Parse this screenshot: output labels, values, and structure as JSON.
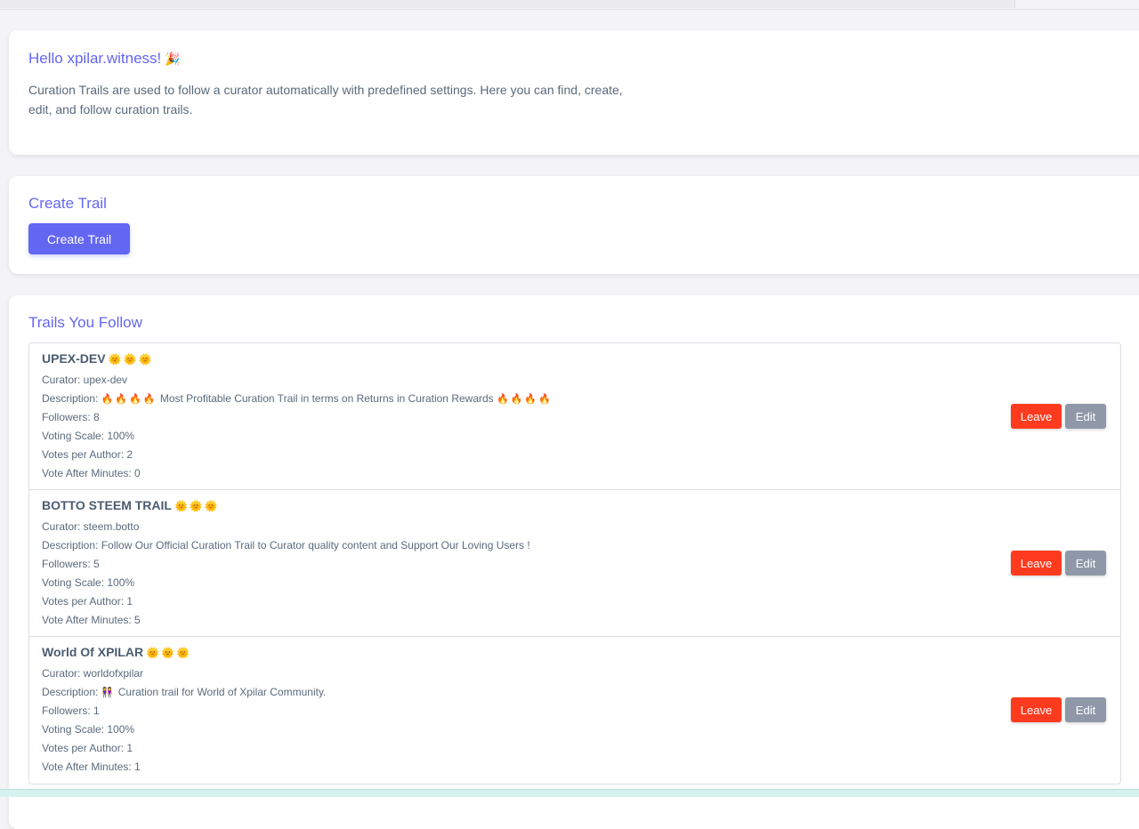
{
  "colors": {
    "accent": "#6366f1",
    "leave": "#ff3b1f",
    "edit": "#8e98a8",
    "text": "#5b6a7c"
  },
  "hello": {
    "title": "Hello xpilar.witness!",
    "title_emoji": "🎉",
    "text": "Curation Trails are used to follow a curator automatically with predefined settings. Here you can find, create, edit, and follow curation trails."
  },
  "create": {
    "title": "Create Trail",
    "button_label": "Create Trail"
  },
  "follow": {
    "title": "Trails You Follow",
    "leave_label": "Leave",
    "edit_label": "Edit",
    "trails": [
      {
        "name": "UPEX-DEV",
        "badges": "🌞🌞🌞",
        "curator": "Curator: upex-dev",
        "description_label": "Description:",
        "description_emoji_pre": "🔥🔥🔥🔥",
        "description": "Most Profitable Curation Trail in terms on Returns in Curation Rewards",
        "description_emoji_post": "🔥🔥🔥🔥",
        "followers": "Followers: 8",
        "voting_scale": "Voting Scale: 100%",
        "votes_per_author": "Votes per Author: 2",
        "vote_after": "Vote After Minutes: 0"
      },
      {
        "name": "BOTTO STEEM TRAIL",
        "badges": "🌞🌞🌞",
        "curator": "Curator: steem.botto",
        "description_label": "Description:",
        "description_emoji_pre": "",
        "description": "Follow Our Official Curation Trail to Curator quality content and Support Our Loving Users !",
        "description_emoji_post": "",
        "followers": "Followers: 5",
        "voting_scale": "Voting Scale: 100%",
        "votes_per_author": "Votes per Author: 1",
        "vote_after": "Vote After Minutes: 5"
      },
      {
        "name": "World Of XPILAR",
        "badges": "🌞🌞🌞",
        "curator": "Curator: worldofxpilar",
        "description_label": "Description:",
        "description_emoji_pre": "👭",
        "description": "Curation trail for World of Xpilar Community.",
        "description_emoji_post": "",
        "followers": "Followers: 1",
        "voting_scale": "Voting Scale: 100%",
        "votes_per_author": "Votes per Author: 1",
        "vote_after": "Vote After Minutes: 1"
      }
    ]
  }
}
